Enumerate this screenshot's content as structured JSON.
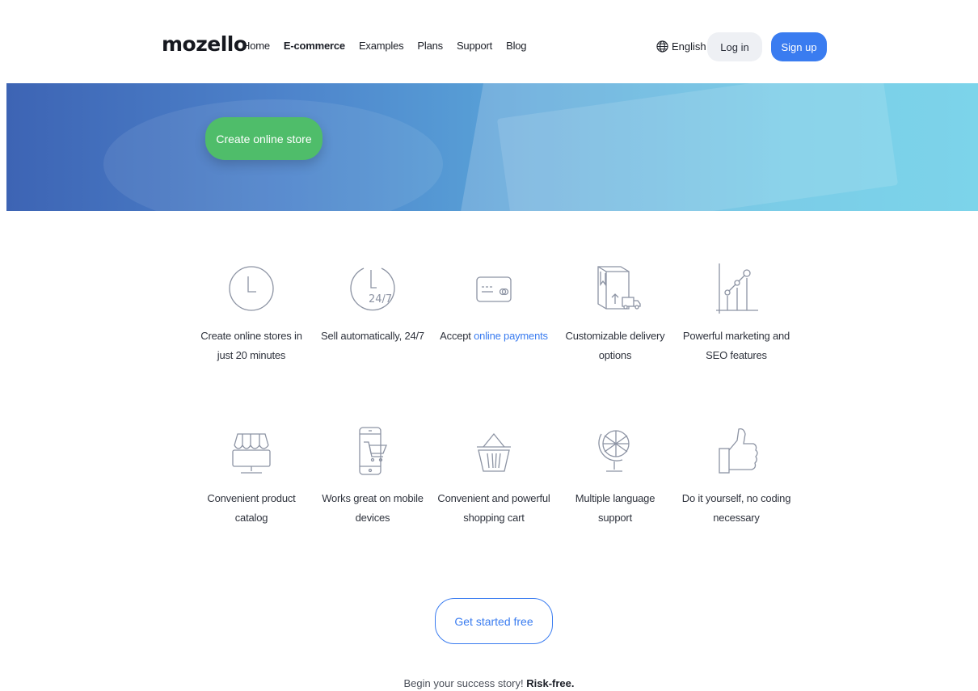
{
  "header": {
    "logo": "mozello",
    "nav": [
      "Home",
      "E-commerce",
      "Examples",
      "Plans",
      "Support",
      "Blog"
    ],
    "language": "English",
    "login": "Log in",
    "signup": "Sign up"
  },
  "hero": {
    "cta": "Create online store"
  },
  "features": [
    {
      "icon": "clock-icon",
      "label": "Create online stores in just 20 minutes"
    },
    {
      "icon": "clock-24-7-icon",
      "label": "Sell automatically, 24/7"
    },
    {
      "icon": "credit-card-icon",
      "label_prefix": "Accept ",
      "label_link": "online payments"
    },
    {
      "icon": "delivery-box-icon",
      "label": "Customizable delivery options"
    },
    {
      "icon": "growth-chart-icon",
      "label": "Powerful marketing and SEO features"
    },
    {
      "icon": "storefront-icon",
      "label": "Convenient product catalog"
    },
    {
      "icon": "mobile-cart-icon",
      "label": "Works great on mobile devices"
    },
    {
      "icon": "basket-icon",
      "label": "Convenient and powerful shopping cart"
    },
    {
      "icon": "globe-icon",
      "label": "Multiple language support"
    },
    {
      "icon": "thumbs-up-icon",
      "label": "Do it yourself, no coding necessary"
    }
  ],
  "cta_bottom": "Get started free",
  "footer_note": {
    "text": "Begin your success story! ",
    "bold": "Risk-free."
  },
  "colors": {
    "accent": "#3a7cf0",
    "green": "#4fbd6a"
  }
}
